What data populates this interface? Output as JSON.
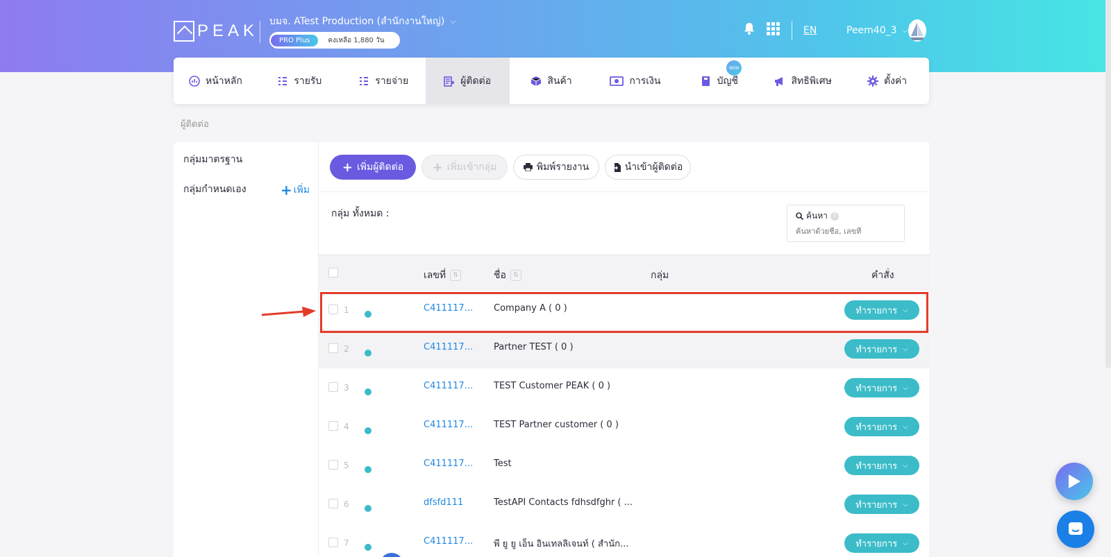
{
  "header": {
    "logo_text": "PEAK",
    "company": "บมจ. ATest Production (สำนักงานใหญ่)",
    "plan": "PRO Plus",
    "remaining": "คงเหลือ 1,880 วัน",
    "lang": "EN",
    "username": "Peem40_3"
  },
  "nav": [
    {
      "label": "หน้าหลัก",
      "icon": "dashboard-icon"
    },
    {
      "label": "รายรับ",
      "icon": "income-list-icon"
    },
    {
      "label": "รายจ่าย",
      "icon": "expense-list-icon"
    },
    {
      "label": "ผู้ติดต่อ",
      "icon": "contacts-icon"
    },
    {
      "label": "สินค้า",
      "icon": "product-box-icon"
    },
    {
      "label": "การเงิน",
      "icon": "money-icon"
    },
    {
      "label": "บัญชี",
      "icon": "accounting-book-icon",
      "badge": "NEW"
    },
    {
      "label": "สิทธิพิเศษ",
      "icon": "megaphone-icon"
    },
    {
      "label": "ตั้งค่า",
      "icon": "gear-icon"
    }
  ],
  "breadcrumb": "ผู้ติดต่อ",
  "sidebar": {
    "standard_group": "กลุ่มมาตรฐาน",
    "custom_group": "กลุ่มกำหนดเอง",
    "add_label": "เพิ่ม"
  },
  "toolbar": {
    "add_contact": "เพิ่มผู้ติดต่อ",
    "add_to_group": "เพิ่มเข้ากลุ่ม",
    "print_report": "พิมพ์รายงาน",
    "import_contacts": "นำเข้าผู้ติดต่อ"
  },
  "group_title": "กลุ่ม ทั้งหมด :",
  "search": {
    "label": "ค้นหา",
    "placeholder": "ค้นหาด้วยชื่อ, เลขที่"
  },
  "table": {
    "headers": {
      "code": "เลขที่",
      "name": "ชื่อ",
      "group": "กลุ่ม",
      "action": "คำสั่ง"
    },
    "action_label": "ทำรายการ",
    "rows": [
      {
        "num": "1",
        "code": "C411117...",
        "name": "Company A ( 0 )"
      },
      {
        "num": "2",
        "code": "C411117...",
        "name": "Partner TEST ( 0 )"
      },
      {
        "num": "3",
        "code": "C411117...",
        "name": "TEST Customer PEAK ( 0 )"
      },
      {
        "num": "4",
        "code": "C411117...",
        "name": "TEST Partner customer ( 0 )"
      },
      {
        "num": "5",
        "code": "C411117...",
        "name": "Test"
      },
      {
        "num": "6",
        "code": "dfsfd111",
        "name": "TestAPI Contacts fdhsdfghr ( ..."
      },
      {
        "num": "7",
        "code": "C411117...",
        "name": "พี ยู ยู เอ็น อินเทลลิเจนท์ ( สำนัก..."
      }
    ]
  },
  "avatar_text": "PEAK",
  "colors": {
    "primary": "#6a5ae0",
    "teal": "#3bbcc8",
    "link": "#1e88e5",
    "highlight": "#e33b2a"
  }
}
